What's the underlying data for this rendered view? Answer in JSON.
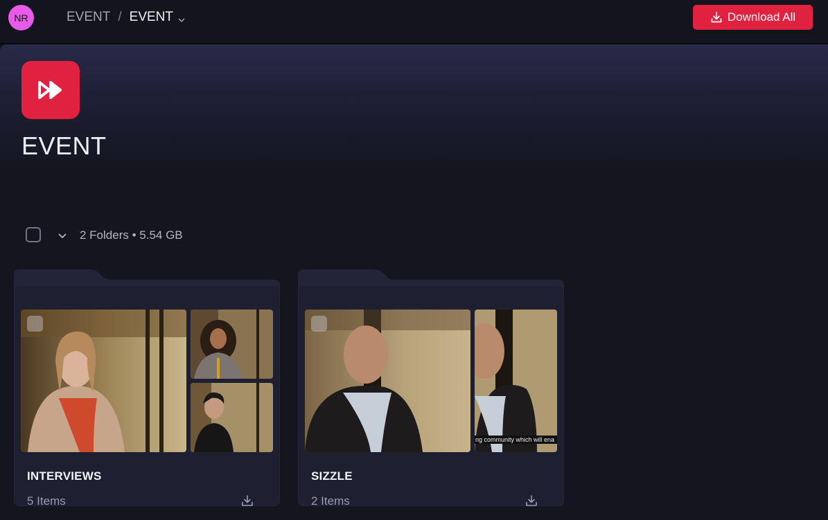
{
  "header": {
    "avatar_initials": "NR",
    "breadcrumb": [
      "EVENT",
      "EVENT"
    ],
    "breadcrumb_separator": "/",
    "download_all_label": "Download All"
  },
  "page": {
    "title": "EVENT",
    "summary": "2 Folders • 5.54 GB"
  },
  "folders": [
    {
      "name": "INTERVIEWS",
      "count": "5 Items"
    },
    {
      "name": "SIZZLE",
      "count": "2 Items",
      "caption": "ng community which will ena"
    }
  ],
  "colors": {
    "accent": "#e0213f",
    "avatar": "#e85ae8",
    "background": "#14151f",
    "card": "#1e1f30"
  },
  "icons": {
    "logo": "fast-forward-icon",
    "download": "download-icon",
    "chevron": "chevron-down-icon"
  }
}
